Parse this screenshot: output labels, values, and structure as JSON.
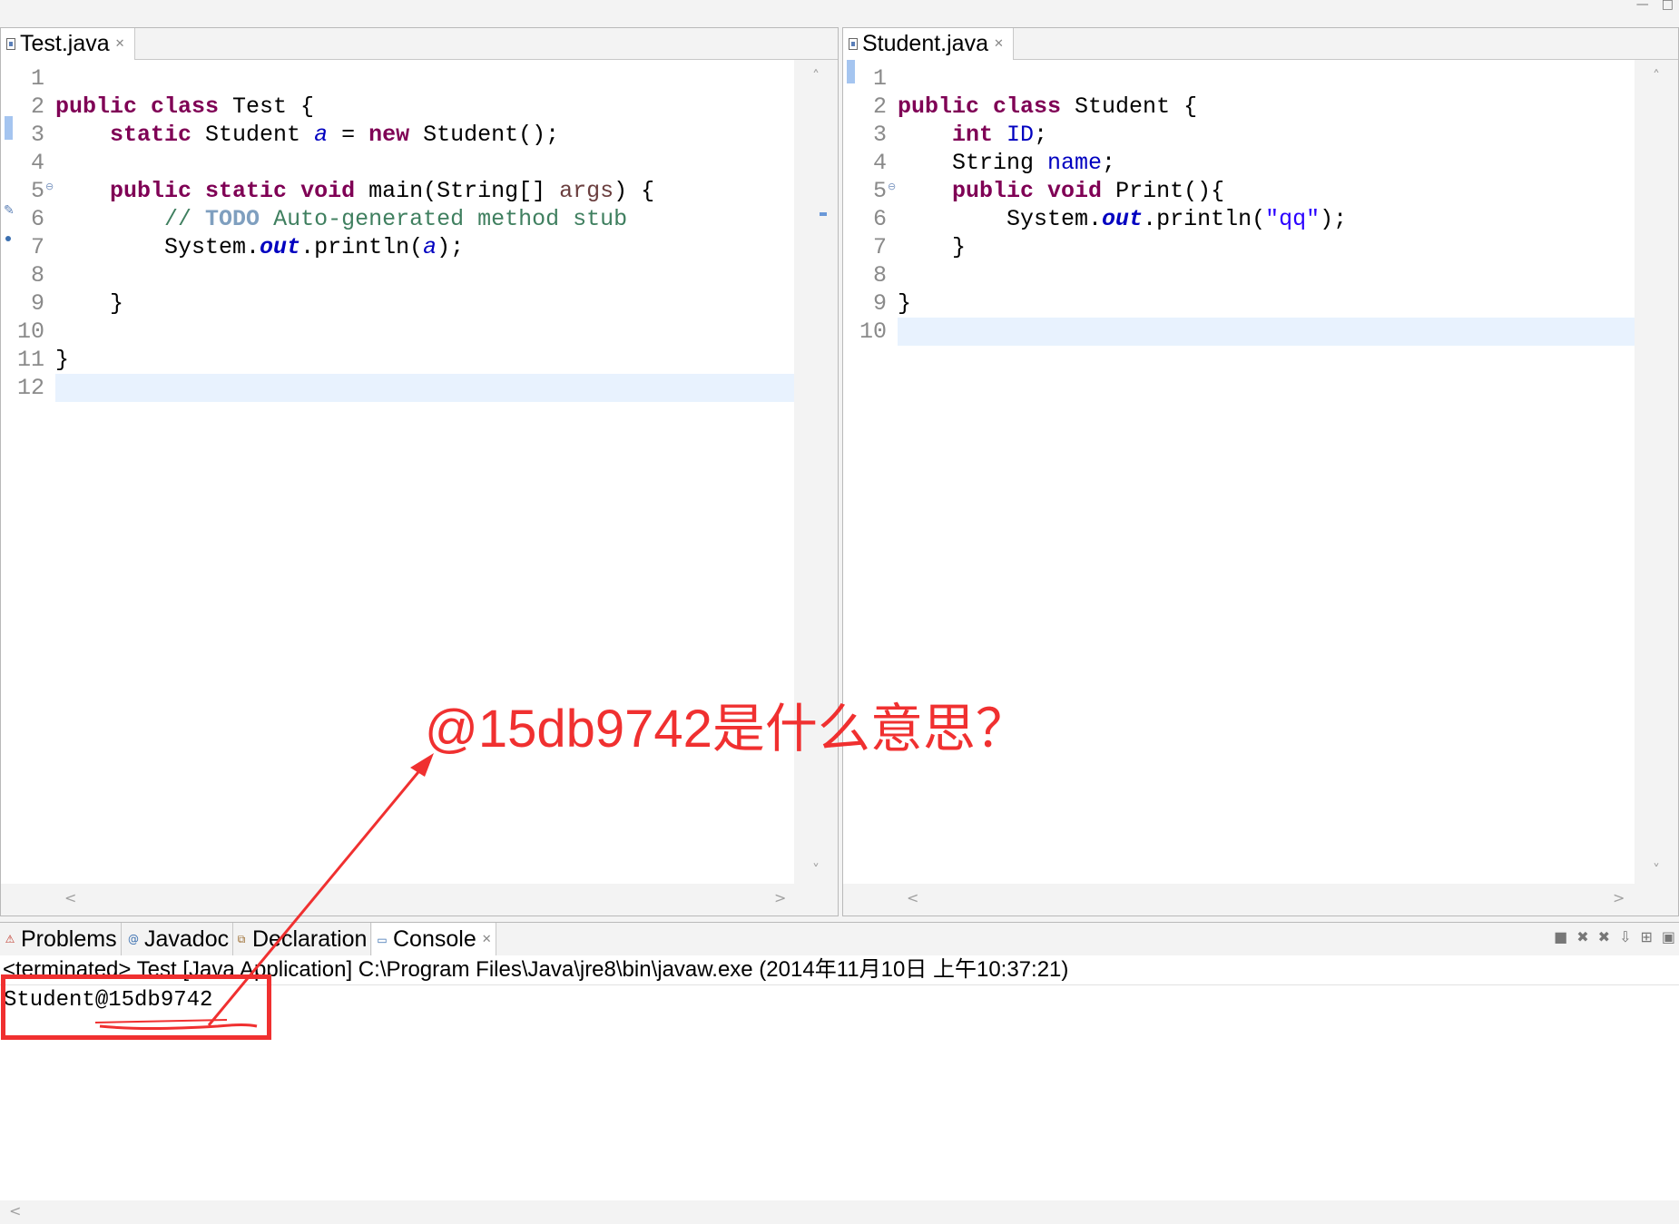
{
  "window": {
    "minimize_glyph": "—",
    "restore_glyph": "□"
  },
  "editors": {
    "left": {
      "tab_label": "Test.java",
      "close_glyph": "✕",
      "line_numbers": [
        "1",
        "2",
        "3",
        "4",
        "5",
        "6",
        "7",
        "8",
        "9",
        "10",
        "11",
        "12"
      ],
      "current_line": 12,
      "lines": [
        [],
        [
          {
            "t": "public",
            "c": "kw"
          },
          {
            "t": " "
          },
          {
            "t": "class",
            "c": "kw"
          },
          {
            "t": " Test {"
          }
        ],
        [
          {
            "t": "    "
          },
          {
            "t": "static",
            "c": "kw"
          },
          {
            "t": " Student "
          },
          {
            "t": "a",
            "c": "static-field"
          },
          {
            "t": " = "
          },
          {
            "t": "new",
            "c": "kw"
          },
          {
            "t": " Student();"
          }
        ],
        [],
        [
          {
            "t": "    "
          },
          {
            "t": "public",
            "c": "kw"
          },
          {
            "t": " "
          },
          {
            "t": "static",
            "c": "kw"
          },
          {
            "t": " "
          },
          {
            "t": "void",
            "c": "kw"
          },
          {
            "t": " main(String[] "
          },
          {
            "t": "args",
            "c": "param"
          },
          {
            "t": ") {"
          }
        ],
        [
          {
            "t": "        "
          },
          {
            "t": "// ",
            "c": "comment"
          },
          {
            "t": "TODO",
            "c": "todo"
          },
          {
            "t": " Auto-generated method stub",
            "c": "comment"
          }
        ],
        [
          {
            "t": "        System."
          },
          {
            "t": "out",
            "c": "static-field-b"
          },
          {
            "t": ".println("
          },
          {
            "t": "a",
            "c": "static-field"
          },
          {
            "t": ");"
          }
        ],
        [],
        [
          {
            "t": "    }"
          }
        ],
        [],
        [
          {
            "t": "}"
          }
        ],
        []
      ]
    },
    "right": {
      "tab_label": "Student.java",
      "close_glyph": "✕",
      "line_numbers": [
        "1",
        "2",
        "3",
        "4",
        "5",
        "6",
        "7",
        "8",
        "9",
        "10"
      ],
      "current_line": 10,
      "lines": [
        [],
        [
          {
            "t": "public",
            "c": "kw"
          },
          {
            "t": " "
          },
          {
            "t": "class",
            "c": "kw"
          },
          {
            "t": " Student {"
          }
        ],
        [
          {
            "t": "    "
          },
          {
            "t": "int",
            "c": "kw"
          },
          {
            "t": " "
          },
          {
            "t": "ID",
            "c": "field"
          },
          {
            "t": ";"
          }
        ],
        [
          {
            "t": "    String "
          },
          {
            "t": "name",
            "c": "field"
          },
          {
            "t": ";"
          }
        ],
        [
          {
            "t": "    "
          },
          {
            "t": "public",
            "c": "kw"
          },
          {
            "t": " "
          },
          {
            "t": "void",
            "c": "kw"
          },
          {
            "t": " Print(){"
          }
        ],
        [
          {
            "t": "        System."
          },
          {
            "t": "out",
            "c": "static-field-b"
          },
          {
            "t": ".println("
          },
          {
            "t": "\"qq\"",
            "c": "str"
          },
          {
            "t": ");"
          }
        ],
        [
          {
            "t": "    }"
          }
        ],
        [],
        [
          {
            "t": "}"
          }
        ],
        []
      ]
    },
    "scroll": {
      "up": "˄",
      "down": "˅",
      "left": "<",
      "right": ">"
    }
  },
  "console_view": {
    "tabs": [
      {
        "label": "Problems",
        "icon": "problems-icon",
        "glyph": "⚠"
      },
      {
        "label": "Javadoc",
        "icon": "javadoc-icon",
        "glyph": "@"
      },
      {
        "label": "Declaration",
        "icon": "declaration-icon",
        "glyph": "⧉"
      },
      {
        "label": "Console",
        "icon": "console-icon",
        "glyph": "▭",
        "active": true
      }
    ],
    "close_glyph": "✕",
    "toolbar": [
      {
        "name": "terminate-icon",
        "glyph": "■"
      },
      {
        "name": "remove-launch-icon",
        "glyph": "✖"
      },
      {
        "name": "remove-all-terminated-icon",
        "glyph": "✖"
      },
      {
        "name": "scroll-lock-icon",
        "glyph": "⇩"
      },
      {
        "name": "pin-console-icon",
        "glyph": "⊞"
      },
      {
        "name": "display-console-icon",
        "glyph": "▣"
      }
    ],
    "header": "<terminated> Test [Java Application] C:\\Program Files\\Java\\jre8\\bin\\javaw.exe (2014年11月10日 上午10:37:21)",
    "output": "Student@15db9742",
    "hscroll_left": "<"
  },
  "annotation": {
    "question": "@15db9742是什么意思？",
    "color": "#f03030"
  }
}
